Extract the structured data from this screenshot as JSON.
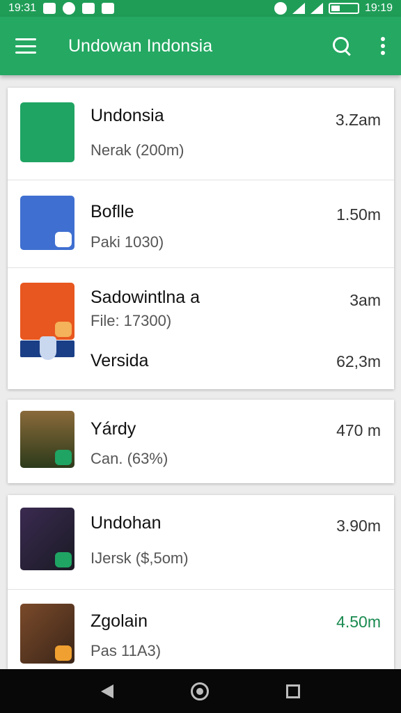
{
  "status_bar": {
    "time": "19:31",
    "clock_right": "19:19",
    "icons": [
      "notification-icon",
      "circle-icon",
      "mail-icon",
      "image-icon",
      "vibrate-icon",
      "wifi-icon",
      "signal-icon",
      "battery-icon"
    ]
  },
  "appbar": {
    "title": "Undowan Indonsia",
    "icons": [
      "menu-icon",
      "search-icon",
      "overflow-icon"
    ]
  },
  "cards": [
    {
      "items": [
        {
          "title": "Undonsia",
          "subtitle": "Nerak (200m)",
          "time": "3.Zam",
          "icon": "flame-icon",
          "color": "#1fa463"
        },
        {
          "title": "Boflle",
          "subtitle": "Paki 1030)",
          "time": "1.50m",
          "icon": "envelope-icon",
          "color": "#3f6fd0"
        },
        {
          "title": "Sadowintlna a",
          "subtitle": "File: 17300)",
          "time": "3am",
          "icon": "house-icon",
          "color": "#e8571f"
        },
        {
          "title": "Versida",
          "subtitle": "",
          "time": "62,3m",
          "icon": "shield-icon",
          "color": "#1b3f86"
        }
      ]
    },
    {
      "items": [
        {
          "title": "Yárdy",
          "subtitle": "Can. (63%)",
          "time": "470 m",
          "icon": "tree-icon",
          "color": "#4a4a2a"
        }
      ]
    },
    {
      "items": [
        {
          "title": "Undohan",
          "subtitle": "IJersk ($,5om)",
          "time": "3.90m",
          "icon": "tablet-icon",
          "color": "#2a2a40"
        },
        {
          "title": "Zgolain",
          "subtitle": "Pas 11A3)",
          "time": "4.50m",
          "icon": "phone-icon",
          "color": "#5a3a22",
          "time_color": "#1a8a50"
        }
      ]
    }
  ],
  "navbar": {
    "icons": [
      "back-icon",
      "home-icon",
      "recents-icon"
    ]
  }
}
